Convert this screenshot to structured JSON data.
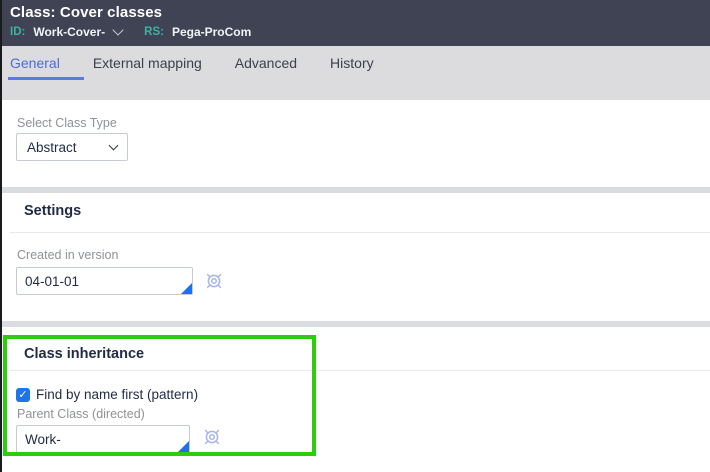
{
  "header": {
    "title": "Class: Cover classes",
    "id_label": "ID:",
    "id_value": "Work-Cover-",
    "rs_label": "RS:",
    "rs_value": "Pega-ProCom"
  },
  "tabs": [
    {
      "label": "General",
      "active": true
    },
    {
      "label": "External mapping",
      "active": false
    },
    {
      "label": "Advanced",
      "active": false
    },
    {
      "label": "History",
      "active": false
    }
  ],
  "form": {
    "class_type": {
      "label": "Select Class Type",
      "value": "Abstract"
    },
    "settings_section": {
      "title": "Settings",
      "created_in_version": {
        "label": "Created in version",
        "value": "04-01-01"
      }
    },
    "inheritance_section": {
      "title": "Class inheritance",
      "find_by_name": {
        "label": "Find by name first (pattern)",
        "checked": true
      },
      "parent_class": {
        "label": "Parent Class (directed)",
        "value": "Work-"
      }
    }
  },
  "icons": {
    "check_glyph": "✓",
    "id_chevron": "chevron-down",
    "select_chevron": "chevron-down",
    "config_icon": "gear-target"
  },
  "colors": {
    "header_bg": "#3f4354",
    "accent_teal": "#3eb2a1",
    "tabbar_bg": "#dcdcdf",
    "active_tab_blue": "#4a6ce0",
    "checkbox_blue": "#1e74e8",
    "smart_prompt_triangle": "#1e6fe8",
    "gear_icon": "#a7b4ee",
    "annotation_green": "#2ecc0e"
  }
}
